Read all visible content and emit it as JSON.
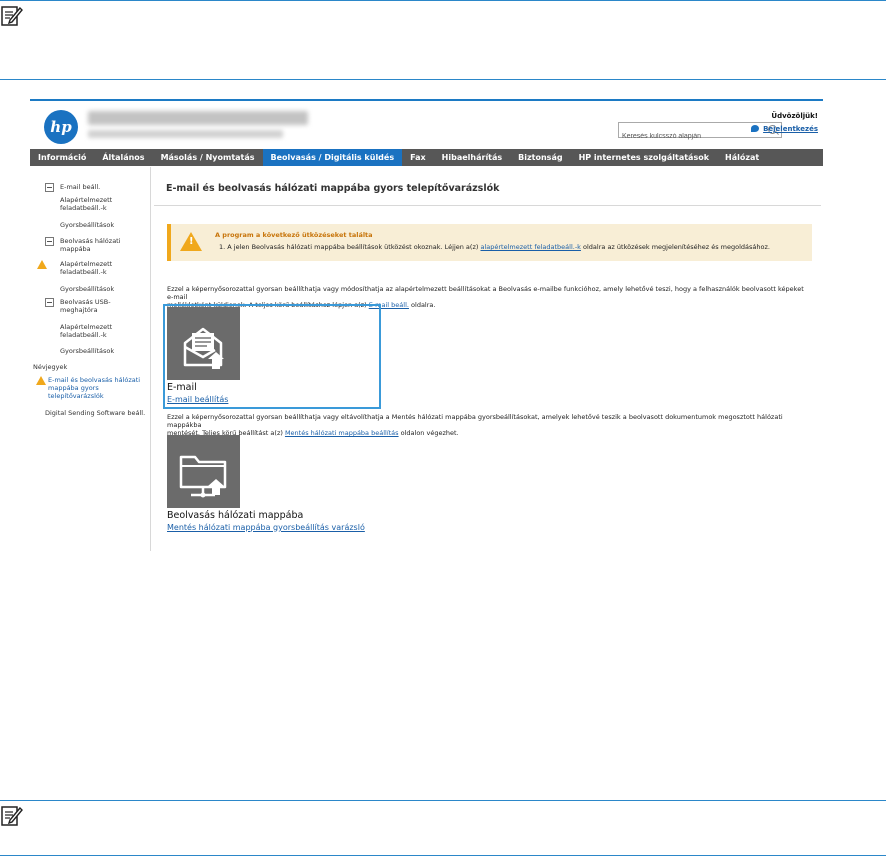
{
  "screenshot": {
    "search": {
      "placeholder": "Keresés kulcsszó alapján"
    },
    "welcome": "Üdvözöljük!",
    "login": "Bejelentkezés",
    "nav": [
      {
        "label": "Információ"
      },
      {
        "label": "Általános"
      },
      {
        "label": "Másolás / Nyomtatás"
      },
      {
        "label": "Beolvasás / Digitális küldés",
        "active": true
      },
      {
        "label": "Fax"
      },
      {
        "label": "Hibaelhárítás"
      },
      {
        "label": "Biztonság"
      },
      {
        "label": "HP internetes szolgáltatások"
      },
      {
        "label": "Hálózat"
      }
    ],
    "sidebar": {
      "email_settings": "E-mail beáll.",
      "email_defaults_1": "Alapértelmezett",
      "email_defaults_2": "feladatbeáll.-k",
      "email_quick": "Gyorsbeállítások",
      "scan_folder_1": "Beolvasás hálózati",
      "scan_folder_2": "mappába",
      "folder_defaults_1": "Alapértelmezett",
      "folder_defaults_2": "feladatbeáll.-k",
      "folder_quick": "Gyorsbeállítások",
      "scan_usb_1": "Beolvasás USB-",
      "scan_usb_2": "meghajtóra",
      "usb_defaults_1": "Alapértelmezett",
      "usb_defaults_2": "feladatbeáll.-k",
      "usb_quick": "Gyorsbeállítások",
      "contacts": "Névjegyek",
      "wizard_1": "E-mail és beolvasás hálózati",
      "wizard_2": "mappába gyors",
      "wizard_3": "telepítővarázslók",
      "dss": "Digital Sending Software beáll."
    },
    "page_title": "E-mail és beolvasás hálózati mappába gyors telepítővarázslók",
    "alert": {
      "title": "A program a következő ütközéseket találta",
      "text_pre": "1.  A jelen Beolvasás hálózati mappába beállítások ütközést okoznak. Léjjen a(z) ",
      "link": "alapértelmezett feladatbeáll.-k",
      "text_post": " oldalra az ütközések megjelenítéséhez és megoldásához."
    },
    "email_para": {
      "line1": "Ezzel a képernyősorozattal gyorsan beállíthatja vagy módosíthatja az alapértelmezett beállításokat a Beolvasás e-mailbe funkcióhoz, amely lehetővé teszi, hogy a felhasználók beolvasott képeket e-mail",
      "line2_pre": "mellékletként küldjenek. A teljes körű beállításhoz lépjen a(z) ",
      "line2_link": "E-mail beáll.",
      "line2_post": " oldalra."
    },
    "email_tile": {
      "title": "E-mail",
      "link": "E-mail beállítás"
    },
    "folder_para": {
      "line1": "Ezzel a képernyősorozattal gyorsan beállíthatja vagy eltávolíthatja a Mentés hálózati mappába gyorsbeállításokat, amelyek lehetővé teszik a beolvasott dokumentumok megosztott hálózati mappákba",
      "line2_pre": "mentését. Teljes körű beállítást a(z) ",
      "line2_link": "Mentés hálózati mappába beállítás",
      "line2_post": " oldalon végezhet."
    },
    "folder_tile": {
      "title": "Beolvasás hálózati mappába",
      "link": "Mentés hálózati mappába gyorsbeállítás varázsló"
    }
  },
  "colors": {
    "accent": "#1a72c1",
    "navbar": "#575757",
    "warning": "#f0a81c",
    "note_rule": "#2b87c9"
  },
  "icons": [
    "note-icon",
    "hp-logo",
    "search-icon",
    "login-icon",
    "warning-icon",
    "email-envelope-icon",
    "network-folder-icon",
    "upload-arrow-icon"
  ]
}
